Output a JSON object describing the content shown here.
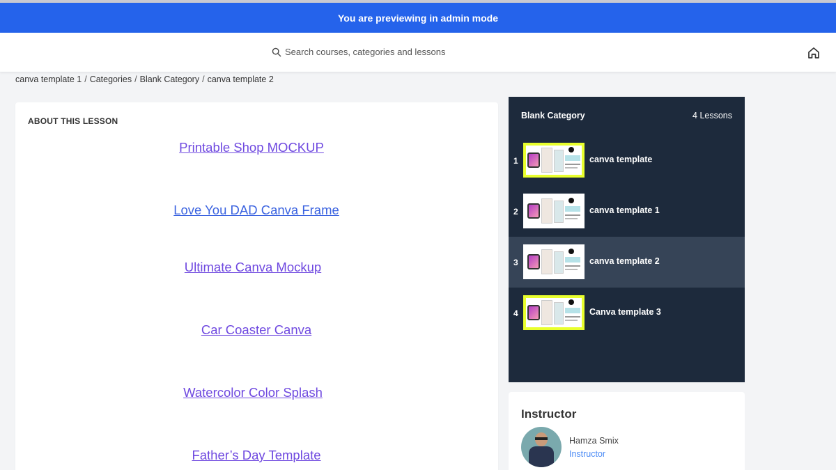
{
  "admin_banner": {
    "text": "You are previewing in admin mode"
  },
  "search": {
    "placeholder": "Search courses, categories and lessons",
    "icon": "search-icon"
  },
  "header": {
    "home_icon": "home-icon"
  },
  "breadcrumb": {
    "items": [
      "canva template 1",
      "Categories",
      "Blank Category",
      "canva template 2"
    ],
    "separator": "/"
  },
  "lesson": {
    "about_heading": "ABOUT THIS LESSON",
    "links": [
      "Printable Shop MOCKUP",
      "Love You DAD Canva Frame",
      "Ultimate Canva Mockup",
      "Car Coaster Canva",
      "Watercolor Color Splash",
      "Father’s Day Template"
    ]
  },
  "lessons_panel": {
    "title": "Blank Category",
    "count": "4 Lessons",
    "items": [
      {
        "num": "1",
        "label": "canva template",
        "highlighted_thumb": true
      },
      {
        "num": "2",
        "label": "canva template 1",
        "highlighted_thumb": false
      },
      {
        "num": "3",
        "label": "canva template 2",
        "highlighted_thumb": false,
        "active": true
      },
      {
        "num": "4",
        "label": "Canva template 3",
        "highlighted_thumb": true
      }
    ]
  },
  "instructor": {
    "heading": "Instructor",
    "name": "Hamza Smix",
    "role": "Instructor"
  },
  "colors": {
    "admin_bar": "#2563eb",
    "panel_bg": "#1d2a3c",
    "panel_active": "#364457",
    "link": "#6f49e0",
    "thumb_highlight": "#e9ff2d",
    "instructor_role": "#4b8bf5"
  }
}
